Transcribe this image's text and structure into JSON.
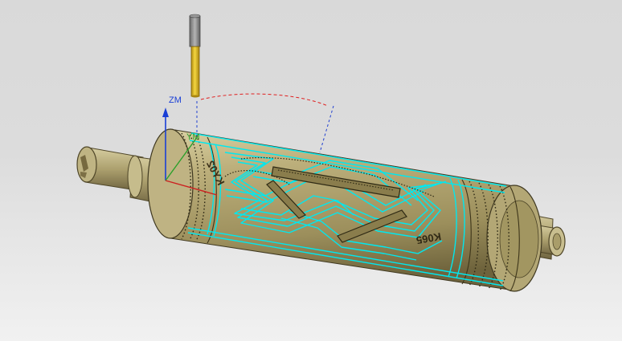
{
  "viewport": {
    "axis_label": "ZM",
    "coord_label": "YM",
    "emboss_left": "KY02",
    "emboss_right": "K065"
  },
  "colors": {
    "toolpath": "#00e8f0",
    "roller_body": "#b0a474",
    "roller_dark": "#5e5430",
    "tool_shank": "#e6c230",
    "tool_holder": "#8a8a8a",
    "axis_z": "#1a3fd6",
    "axis_x": "#cc2020",
    "axis_y": "#2aa02a",
    "arc": "#e02020",
    "projection": "#2040d0"
  }
}
